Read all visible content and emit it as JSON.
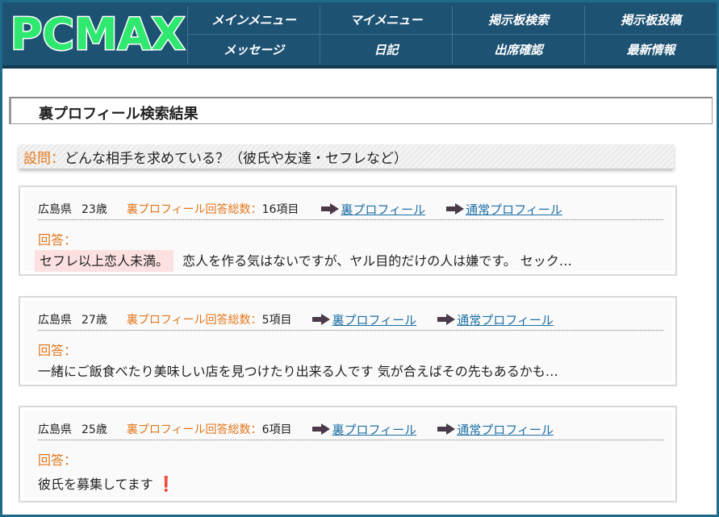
{
  "header": {
    "logo_text": "PCMAX",
    "nav": [
      {
        "label": "メインメニュー"
      },
      {
        "label": "マイメニュー"
      },
      {
        "label": "掲示板検索"
      },
      {
        "label": "掲示板投稿"
      },
      {
        "label": "メッセージ"
      },
      {
        "label": "日記"
      },
      {
        "label": "出席確認"
      },
      {
        "label": "最新情報"
      }
    ]
  },
  "section_title": "裏プロフィール検索結果",
  "question": {
    "label": "設問：",
    "text": "どんな相手を求めている？（彼氏や友達・セフレなど）"
  },
  "labels": {
    "count_label": "裏プロフィール回答総数：",
    "ura_link": "裏プロフィール",
    "normal_link": "通常プロフィール",
    "answer_label": "回答："
  },
  "results": [
    {
      "prefecture": "広島県",
      "age": "23歳",
      "count": "16項目",
      "answer_highlight": "セフレ以上恋人未満。",
      "answer_text": "恋人を作る気はないですが、ヤル目的だけの人は嫌です。 セック…"
    },
    {
      "prefecture": "広島県",
      "age": "27歳",
      "count": "5項目",
      "answer_highlight": "",
      "answer_text": "一緒にご飯食べたり美味しい店を見つけたり出来る人です 気が合えばその先もあるかも…"
    },
    {
      "prefecture": "広島県",
      "age": "25歳",
      "count": "6項目",
      "answer_highlight": "",
      "answer_text": "彼氏を募集してます",
      "emoji": "❗"
    }
  ],
  "colors": {
    "header_bg": "#1d5272",
    "accent_orange": "#e3761a",
    "link_blue": "#1d6fa5",
    "logo_green": "#2ee870"
  }
}
